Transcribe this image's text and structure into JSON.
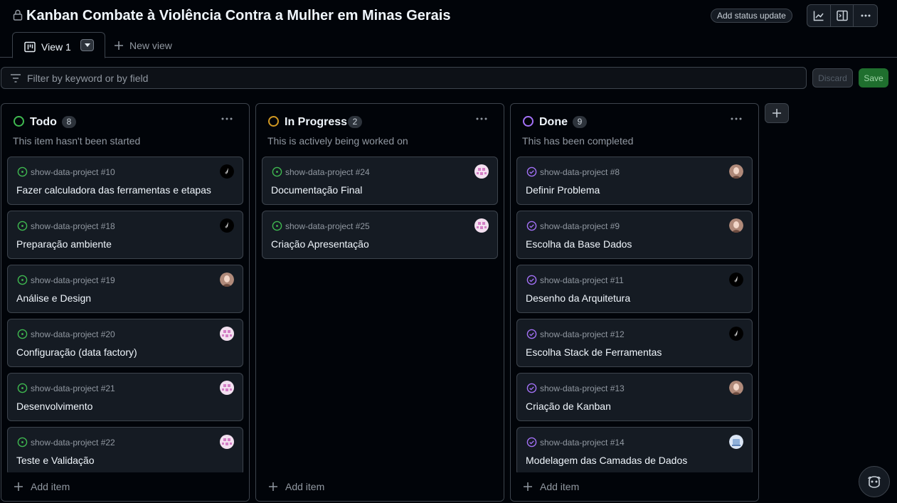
{
  "header": {
    "title": "Kanban Combate à Violência Contra a Mulher em Minas Gerais",
    "status_button": "Add status update"
  },
  "tabs": {
    "active_label": "View 1",
    "new_view_label": "New view"
  },
  "filter": {
    "placeholder": "Filter by keyword or by field",
    "discard_label": "Discard",
    "save_label": "Save"
  },
  "columns": [
    {
      "name": "Todo",
      "count": "8",
      "description": "This item hasn't been started",
      "status_color": "#3fb950",
      "add_label": "Add item",
      "cards": [
        {
          "ref": "show-data-project #10",
          "title": "Fazer calculadora das ferramentas e etapas",
          "avatar": "dark-avatar"
        },
        {
          "ref": "show-data-project #18",
          "title": "Preparação ambiente",
          "avatar": "dark-avatar"
        },
        {
          "ref": "show-data-project #19",
          "title": "Análise e Design",
          "avatar": "photo-avatar"
        },
        {
          "ref": "show-data-project #20",
          "title": "Configuração (data factory)",
          "avatar": "pink-avatar"
        },
        {
          "ref": "show-data-project #21",
          "title": "Desenvolvimento",
          "avatar": "pink-avatar"
        },
        {
          "ref": "show-data-project #22",
          "title": "Teste e Validação",
          "avatar": "pink-avatar"
        }
      ]
    },
    {
      "name": "In Progress",
      "count": "2",
      "description": "This is actively being worked on",
      "status_color": "#d29922",
      "add_label": "Add item",
      "cards": [
        {
          "ref": "show-data-project #24",
          "title": "Documentação Final",
          "avatar": "pink-avatar"
        },
        {
          "ref": "show-data-project #25",
          "title": "Criação Apresentação",
          "avatar": "pink-avatar"
        }
      ]
    },
    {
      "name": "Done",
      "count": "9",
      "description": "This has been completed",
      "status_color": "#a371f7",
      "add_label": "Add item",
      "cards": [
        {
          "ref": "show-data-project #8",
          "title": "Definir Problema",
          "avatar": "photo-avatar"
        },
        {
          "ref": "show-data-project #9",
          "title": "Escolha da Base Dados",
          "avatar": "photo-avatar"
        },
        {
          "ref": "show-data-project #11",
          "title": "Desenho da Arquitetura",
          "avatar": "dark-avatar"
        },
        {
          "ref": "show-data-project #12",
          "title": "Escolha Stack de Ferramentas",
          "avatar": "dark-avatar"
        },
        {
          "ref": "show-data-project #13",
          "title": "Criação de Kanban",
          "avatar": "photo-avatar"
        },
        {
          "ref": "show-data-project #14",
          "title": "Modelagem das Camadas de Dados",
          "avatar": "blue-avatar"
        }
      ]
    }
  ]
}
